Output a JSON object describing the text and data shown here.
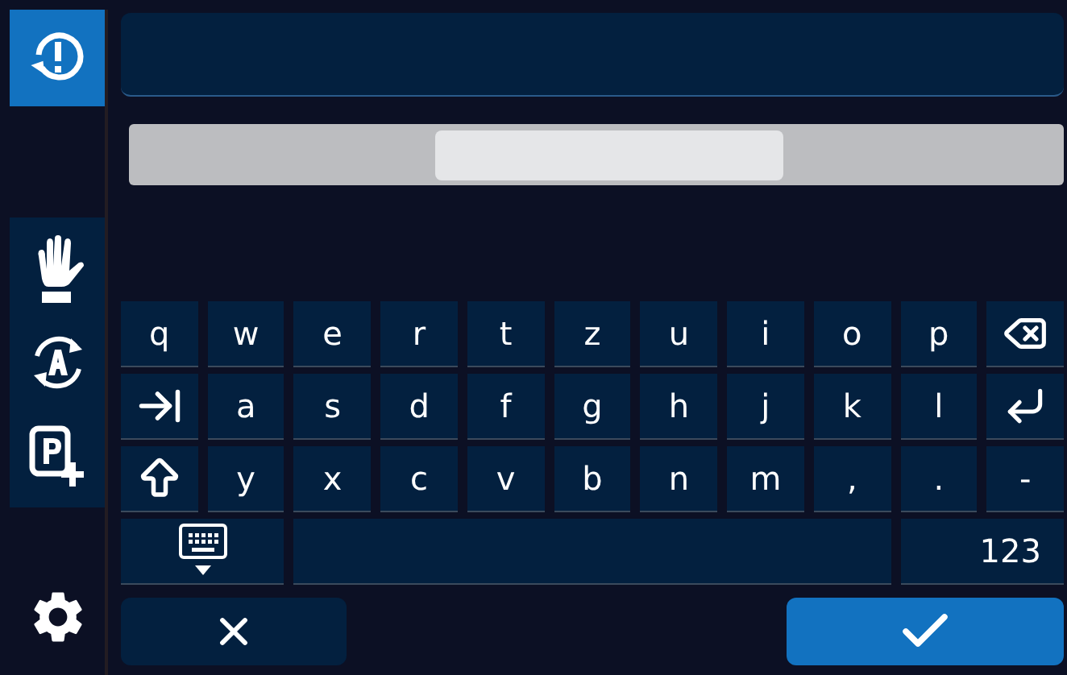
{
  "sidebar": {
    "items": [
      {
        "kind": "history",
        "selected": true
      },
      {
        "kind": "hand",
        "selected": false
      },
      {
        "kind": "auto",
        "selected": false
      },
      {
        "kind": "park",
        "selected": false
      },
      {
        "kind": "settings",
        "selected": false
      }
    ]
  },
  "keyboard": {
    "keys": [
      {
        "kind": "char",
        "label": "q"
      },
      {
        "kind": "char",
        "label": "w"
      },
      {
        "kind": "char",
        "label": "e"
      },
      {
        "kind": "char",
        "label": "r"
      },
      {
        "kind": "char",
        "label": "t"
      },
      {
        "kind": "char",
        "label": "z"
      },
      {
        "kind": "char",
        "label": "u"
      },
      {
        "kind": "char",
        "label": "i"
      },
      {
        "kind": "char",
        "label": "o"
      },
      {
        "kind": "char",
        "label": "p"
      },
      {
        "kind": "backspace"
      },
      {
        "kind": "tab"
      },
      {
        "kind": "char",
        "label": "a"
      },
      {
        "kind": "char",
        "label": "s"
      },
      {
        "kind": "char",
        "label": "d"
      },
      {
        "kind": "char",
        "label": "f"
      },
      {
        "kind": "char",
        "label": "g"
      },
      {
        "kind": "char",
        "label": "h"
      },
      {
        "kind": "char",
        "label": "j"
      },
      {
        "kind": "char",
        "label": "k"
      },
      {
        "kind": "char",
        "label": "l"
      },
      {
        "kind": "enter"
      },
      {
        "kind": "shift"
      },
      {
        "kind": "char",
        "label": "y"
      },
      {
        "kind": "char",
        "label": "x"
      },
      {
        "kind": "char",
        "label": "c"
      },
      {
        "kind": "char",
        "label": "v"
      },
      {
        "kind": "char",
        "label": "b"
      },
      {
        "kind": "char",
        "label": "n"
      },
      {
        "kind": "char",
        "label": "m"
      },
      {
        "kind": "char",
        "label": ","
      },
      {
        "kind": "char",
        "label": "."
      },
      {
        "kind": "char",
        "label": "-"
      },
      {
        "kind": "hide"
      },
      {
        "kind": "space"
      },
      {
        "kind": "mode",
        "label": "123"
      }
    ]
  },
  "actions": [
    {
      "kind": "cancel"
    },
    {
      "kind": "confirm"
    }
  ]
}
